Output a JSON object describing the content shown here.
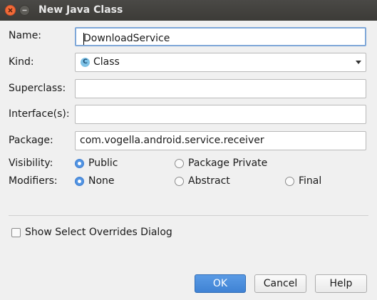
{
  "window": {
    "title": "New Java Class"
  },
  "form": {
    "name_label": "Name:",
    "name_value": "DownloadService",
    "kind_label": "Kind:",
    "kind_value": "Class",
    "kind_icon_letter": "C",
    "superclass_label": "Superclass:",
    "superclass_value": "",
    "interfaces_label": "Interface(s):",
    "interfaces_value": "",
    "package_label": "Package:",
    "package_value": "com.vogella.android.service.receiver",
    "visibility_label": "Visibility:",
    "visibility_options": [
      "Public",
      "Package Private"
    ],
    "visibility_selected": "Public",
    "modifiers_label": "Modifiers:",
    "modifiers_options": [
      "None",
      "Abstract",
      "Final"
    ],
    "modifiers_selected": "None",
    "show_overrides_label": "Show Select Overrides Dialog",
    "show_overrides_checked": false
  },
  "buttons": {
    "ok": "OK",
    "cancel": "Cancel",
    "help": "Help"
  },
  "colors": {
    "accent": "#5294e2",
    "close_button": "#f26b38",
    "titlebar": "#3c3b37"
  }
}
